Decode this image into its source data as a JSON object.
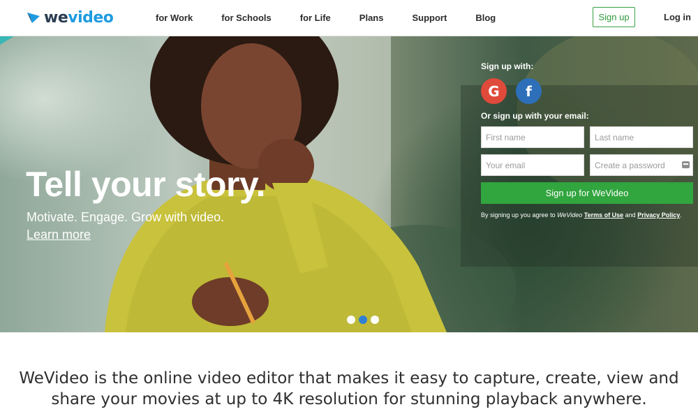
{
  "brand": {
    "logo_prefix": "we",
    "logo_suffix": "video"
  },
  "nav": {
    "items": [
      {
        "label": "for Work"
      },
      {
        "label": "for Schools"
      },
      {
        "label": "for Life"
      },
      {
        "label": "Plans"
      },
      {
        "label": "Support"
      },
      {
        "label": "Blog"
      }
    ],
    "signup_label": "Sign up",
    "login_label": "Log in"
  },
  "hero": {
    "title": "Tell your story.",
    "subtitle": "Motivate. Engage. Grow with video.",
    "learn_more": "Learn more",
    "carousel_active_index": 1,
    "carousel_count": 3
  },
  "signup_panel": {
    "signup_with": "Sign up with:",
    "google_glyph": "G",
    "facebook_glyph": "f",
    "or_email": "Or sign up with your email:",
    "first_name_placeholder": "First name",
    "last_name_placeholder": "Last name",
    "email_placeholder": "Your email",
    "password_placeholder": "Create a password",
    "submit_label": "Sign up for WeVideo",
    "terms_prefix": "By signing up you agree to ",
    "terms_brand": "WeVideo",
    "terms_link": "Terms of Use",
    "terms_and": " and ",
    "privacy_link": "Privacy Policy",
    "terms_suffix": "."
  },
  "tagline": {
    "line1": "WeVideo is the online video editor that makes it easy to capture, create, view and",
    "line2": "share your movies at up to 4K resolution for stunning playback anywhere."
  },
  "colors": {
    "accent_green": "#31a53e",
    "logo_blue": "#1e9be0",
    "google_red": "#e04a3a",
    "facebook_blue": "#2d6fb8",
    "carousel_active": "#2f7fd4"
  },
  "icons": [
    "wevideo-logo-icon",
    "google-icon",
    "facebook-icon",
    "password-key-icon"
  ]
}
